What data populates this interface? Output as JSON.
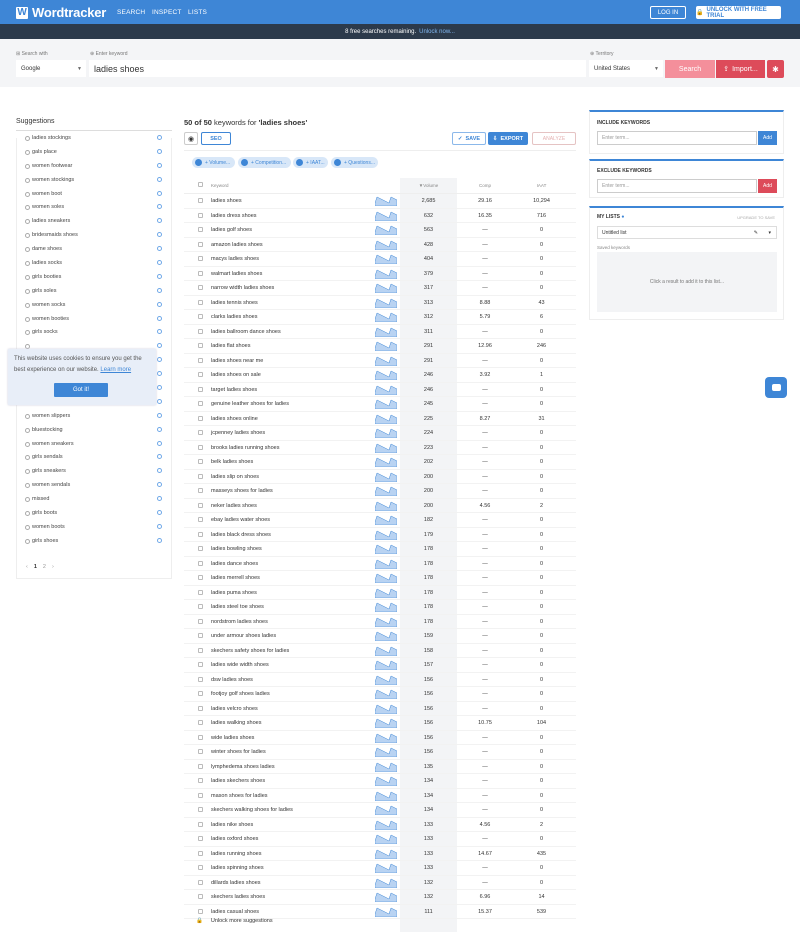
{
  "header": {
    "logo": "Wordtracker",
    "nav": [
      "SEARCH",
      "INSPECT",
      "LISTS"
    ],
    "login": "LOG IN",
    "unlock": "UNLOCK WITH FREE TRIAL",
    "brand_color": "#3e86d6"
  },
  "notice": {
    "text": "8 free searches remaining.",
    "link": "Unlock now..."
  },
  "search": {
    "search_with_label": "Search with",
    "engine": "Google",
    "keyword_label": "Enter keyword",
    "keyword": "ladies shoes",
    "territory_label": "Territory",
    "territory": "United States",
    "search_button": "Search",
    "import_button": "Import..."
  },
  "suggestions": {
    "title": "Suggestions",
    "items": [
      "ladies stockings",
      "gals place",
      "women footwear",
      "women stockings",
      "women boot",
      "women soles",
      "ladies sneakers",
      "bridesmaids shoes",
      "dame shoes",
      "ladies socks",
      "girls booties",
      "girls soles",
      "women socks",
      "women booties",
      "girls socks",
      "",
      "",
      "",
      "",
      "ladies boots",
      "women slippers",
      "bluestocking",
      "women sneakers",
      "girls sendals",
      "girls sneakers",
      "women sendals",
      "missed",
      "girls boots",
      "women boots",
      "girls shoes"
    ],
    "pages": [
      "‹",
      "1",
      "2",
      "›"
    ]
  },
  "cookie": {
    "text": "This website uses cookies to ensure you get the best experience on our website.",
    "link": "Learn more",
    "button": "Got it!"
  },
  "results": {
    "count_prefix": "50 of 50",
    "count_suffix": "keywords for",
    "query": "'ladies shoes'",
    "seo": "SEO",
    "save": "SAVE",
    "export": "EXPORT",
    "analyze": "ANALYZE",
    "filters": [
      "+ Volume...",
      "+ Competition...",
      "+ IAAT...",
      "+ Questions..."
    ],
    "columns": {
      "keyword": "Keyword",
      "volume": "Volume",
      "comp": "Comp",
      "iaat": "IAAT"
    },
    "rows": [
      [
        "ladies shoes",
        "2,685",
        "29.16",
        "10,294"
      ],
      [
        "ladies dress shoes",
        "632",
        "16.35",
        "716"
      ],
      [
        "ladies golf shoes",
        "563",
        "—",
        "0"
      ],
      [
        "amazon ladies shoes",
        "428",
        "—",
        "0"
      ],
      [
        "macys ladies shoes",
        "404",
        "—",
        "0"
      ],
      [
        "walmart ladies shoes",
        "379",
        "—",
        "0"
      ],
      [
        "narrow width ladies shoes",
        "317",
        "—",
        "0"
      ],
      [
        "ladies tennis shoes",
        "313",
        "8.88",
        "43"
      ],
      [
        "clarks ladies shoes",
        "312",
        "5.79",
        "6"
      ],
      [
        "ladies ballroom dance shoes",
        "311",
        "—",
        "0"
      ],
      [
        "ladies flat shoes",
        "291",
        "12.96",
        "246"
      ],
      [
        "ladies shoes near me",
        "291",
        "—",
        "0"
      ],
      [
        "ladies shoes on sale",
        "246",
        "3.92",
        "1"
      ],
      [
        "target ladies shoes",
        "246",
        "—",
        "0"
      ],
      [
        "genuine leather shoes for ladies",
        "245",
        "—",
        "0"
      ],
      [
        "ladies shoes online",
        "225",
        "8.27",
        "31"
      ],
      [
        "jcpenney ladies shoes",
        "224",
        "—",
        "0"
      ],
      [
        "brooks ladies running shoes",
        "223",
        "—",
        "0"
      ],
      [
        "belk ladies shoes",
        "202",
        "—",
        "0"
      ],
      [
        "ladies slip on shoes",
        "200",
        "—",
        "0"
      ],
      [
        "masseys shoes for ladies",
        "200",
        "—",
        "0"
      ],
      [
        "neker ladies shoes",
        "200",
        "4.56",
        "2"
      ],
      [
        "ebay ladies water shoes",
        "182",
        "—",
        "0"
      ],
      [
        "ladies black dress shoes",
        "179",
        "—",
        "0"
      ],
      [
        "ladies bowling shoes",
        "178",
        "—",
        "0"
      ],
      [
        "ladies dance shoes",
        "178",
        "—",
        "0"
      ],
      [
        "ladies merrell shoes",
        "178",
        "—",
        "0"
      ],
      [
        "ladies puma shoes",
        "178",
        "—",
        "0"
      ],
      [
        "ladies steel toe shoes",
        "178",
        "—",
        "0"
      ],
      [
        "nordstrom ladies shoes",
        "178",
        "—",
        "0"
      ],
      [
        "under armour shoes ladies",
        "159",
        "—",
        "0"
      ],
      [
        "skechers safety shoes for ladies",
        "158",
        "—",
        "0"
      ],
      [
        "ladies wide width shoes",
        "157",
        "—",
        "0"
      ],
      [
        "dsw ladies shoes",
        "156",
        "—",
        "0"
      ],
      [
        "footjoy golf shoes ladies",
        "156",
        "—",
        "0"
      ],
      [
        "ladies velcro shoes",
        "156",
        "—",
        "0"
      ],
      [
        "ladies walking shoes",
        "156",
        "10.75",
        "104"
      ],
      [
        "wide ladies shoes",
        "156",
        "—",
        "0"
      ],
      [
        "winter shoes for ladies",
        "156",
        "—",
        "0"
      ],
      [
        "lymphedema shoes ladies",
        "135",
        "—",
        "0"
      ],
      [
        "ladies skechers shoes",
        "134",
        "—",
        "0"
      ],
      [
        "mason shoes for ladies",
        "134",
        "—",
        "0"
      ],
      [
        "skechers walking shoes for ladies",
        "134",
        "—",
        "0"
      ],
      [
        "ladies nike shoes",
        "133",
        "4.56",
        "2"
      ],
      [
        "ladies oxford shoes",
        "133",
        "—",
        "0"
      ],
      [
        "ladies running shoes",
        "133",
        "14.67",
        "435"
      ],
      [
        "ladies spinning shoes",
        "133",
        "—",
        "0"
      ],
      [
        "dillards ladies shoes",
        "132",
        "—",
        "0"
      ],
      [
        "skechers ladies shoes",
        "132",
        "6.96",
        "14"
      ],
      [
        "ladies casual shoes",
        "111",
        "15.37",
        "539"
      ]
    ],
    "unlock_more": "Unlock more suggestions"
  },
  "include": {
    "title": "INCLUDE KEYWORDS",
    "placeholder": "Enter term...",
    "button": "Add"
  },
  "exclude": {
    "title": "EXCLUDE KEYWORDS",
    "placeholder": "Enter term...",
    "button": "Add"
  },
  "lists": {
    "title": "MY LISTS",
    "upgrade": "UPGRADE TO SAVE",
    "list_name": "Untitled list",
    "saved_label": "Saved keywords",
    "empty": "Click a result to add it to this list..."
  }
}
